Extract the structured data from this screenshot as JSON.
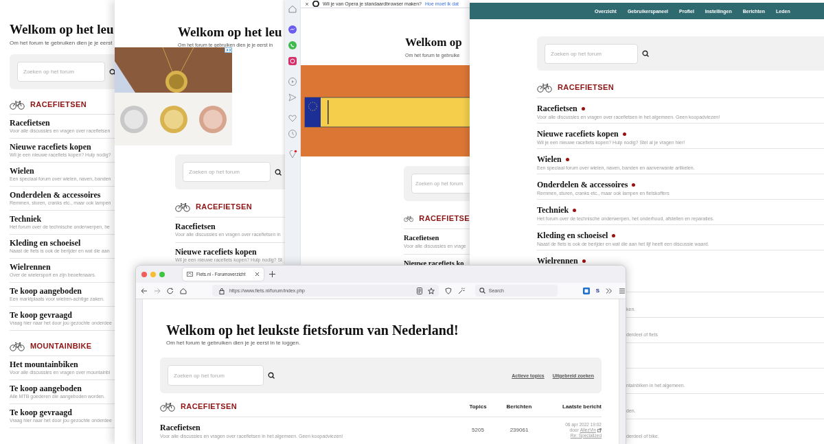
{
  "windows": [
    {
      "kind": "plain_page",
      "heading": "Welkom op het leu",
      "intro": "Om het forum te gebruiken dien je je eerst",
      "search": {
        "placeholder": "Zoeken op het forum"
      },
      "sections": [
        {
          "title": "RACEFIETSEN",
          "forums": [
            {
              "title": "Racefietsen",
              "description": "Voor alle discussies en vragen over racefietsen"
            },
            {
              "title": "Nieuwe racefiets kopen",
              "description": "Wil je een nieuwe racefiets kopen? Hulp nodig?"
            },
            {
              "title": "Wielen",
              "description": "Een speciaal forum over wielen, naven, banden"
            },
            {
              "title": "Onderdelen & accessoires",
              "description": "Remmen, sturen, cranks etc., maar ook lampen"
            },
            {
              "title": "Techniek",
              "description": "Het forum over de technische onderwerpen, he"
            },
            {
              "title": "Kleding en schoeisel",
              "description": "Naast de fiets is ook de berijder en wat die aan"
            },
            {
              "title": "Wielrennen",
              "description": "Over de wielersport en zijn beoefenaars."
            },
            {
              "title": "Te koop aangeboden",
              "description": "Een marktplaats voor wielren-achtige zaken."
            },
            {
              "title": "Te koop gevraagd",
              "description": "Vraag hier naar het door jou gezochte onderdee"
            }
          ]
        },
        {
          "title": "MOUNTAINBIKE",
          "forums": [
            {
              "title": "Het mountainbiken",
              "description": "Voor alle discussies en vragen over mountainbi"
            },
            {
              "title": "Te koop aangeboden",
              "description": "Alle MTB goederen die aangeboden worden."
            },
            {
              "title": "Te koop gevraagd",
              "description": "Vraag hier naar het door jou gezochte onderdee"
            }
          ]
        }
      ]
    },
    {
      "kind": "ad_page",
      "heading": "Welkom op het leu",
      "intro": "Om het forum te gebruiken dien je je eerst in",
      "search": {
        "placeholder": "Zoeken op het forum"
      },
      "sections": [
        {
          "title": "RACEFIETSEN",
          "forums": [
            {
              "title": "Racefietsen",
              "description": "Voor alle discussies en vragen over racefietsen in"
            },
            {
              "title": "Nieuwe racefiets kopen",
              "description": "Wil je een nieuwe racefiets kopen? Hulp nodig? St"
            }
          ]
        }
      ]
    },
    {
      "kind": "opera",
      "notice": "Wil je van Opera je standaardbrowser maken?",
      "notice_link": "Hoe moet ik dat",
      "heading": "Welkom op",
      "intro": "Om het forum te gebruike",
      "search": {
        "placeholder": "Zoeken op het forum"
      },
      "sections": [
        {
          "title": "RACEFIETSE",
          "forums": [
            {
              "title": "Racefietsen",
              "description": "Voor alle discussies en vrage"
            },
            {
              "title": "Nieuwe racefiets ko"
            }
          ]
        }
      ]
    },
    {
      "kind": "nav_page",
      "nav": [
        {
          "label": "Overzicht"
        },
        {
          "label": "Gebruikerspaneel"
        },
        {
          "label": "Profiel"
        },
        {
          "label": "Instellingen"
        },
        {
          "label": "Berichten"
        },
        {
          "label": "Leden"
        }
      ],
      "search": {
        "placeholder": "Zoeken op het forum"
      },
      "sections": [
        {
          "title": "RACEFIETSEN",
          "forums": [
            {
              "title": "Racefietsen",
              "unread": true,
              "description": "Voor alle discussies en vragen over racefietsen in het algemeen. Geen koopadviezen!"
            },
            {
              "title": "Nieuwe racefiets kopen",
              "unread": true,
              "description": "Wil je een nieuwe racefiets kopen? Hulp nodig? Stel al je vragen hier!"
            },
            {
              "title": "Wielen",
              "unread": true,
              "description": "Een speciaal forum over wielen, naven, banden en aanverwante artikelen."
            },
            {
              "title": "Onderdelen & accessoires",
              "unread": true,
              "description": "Remmen, sturen, cranks etc., maar ook lampen en fietskoffers"
            },
            {
              "title": "Techniek",
              "unread": true,
              "description": "Het forum over de technische onderwerpen, het onderhoud, afstellen en reparaties."
            },
            {
              "title": "Kleding en schoeisel",
              "unread": true,
              "description": "Naast de fiets is ook de berijder en wat die aan het lijf heeft een discussie waard."
            },
            {
              "title": "Wielrennen",
              "unread": true
            }
          ]
        }
      ],
      "tail": [
        {
          "kind": "row",
          "description": "ken."
        },
        {
          "kind": "row",
          "description": "derdeel of fiets"
        },
        {
          "kind": "gap"
        },
        {
          "kind": "row",
          "description": "ntainbiken in het algemeen."
        },
        {
          "kind": "row",
          "description": "den."
        },
        {
          "kind": "row",
          "description": "derdeel of bike."
        }
      ]
    },
    {
      "kind": "firefox",
      "tab": {
        "title": "Fiets.nl - Forumoverzicht",
        "selected": true
      },
      "url": "https://www.fiets.nl/forum/index.php",
      "browser_search": {
        "placeholder": "Search"
      },
      "extension_label": "S",
      "heading": "Welkom op het leukste fietsforum van Nederland!",
      "intro": "Om het forum te gebruiken dien je je eerst in te loggen.",
      "search": {
        "placeholder": "Zoeken op het forum"
      },
      "search_links": [
        "Actieve topics",
        "Uitgebreid zoeken"
      ],
      "table": {
        "section": "RACEFIETSEN",
        "columns": [
          "Topics",
          "Berichten",
          "Laatste bericht"
        ],
        "rows": [
          {
            "title": "Racefietsen",
            "description": "Voor alle discussies en vragen over racefietsen in het algemeen. Geen koopadviezen!",
            "topics": "5205",
            "posts": "239061",
            "last_post": {
              "date": "06 apr 2022 19:02",
              "by": "door",
              "author": "AllezVin",
              "topic": "Re: Specialized"
            }
          }
        ]
      }
    }
  ]
}
